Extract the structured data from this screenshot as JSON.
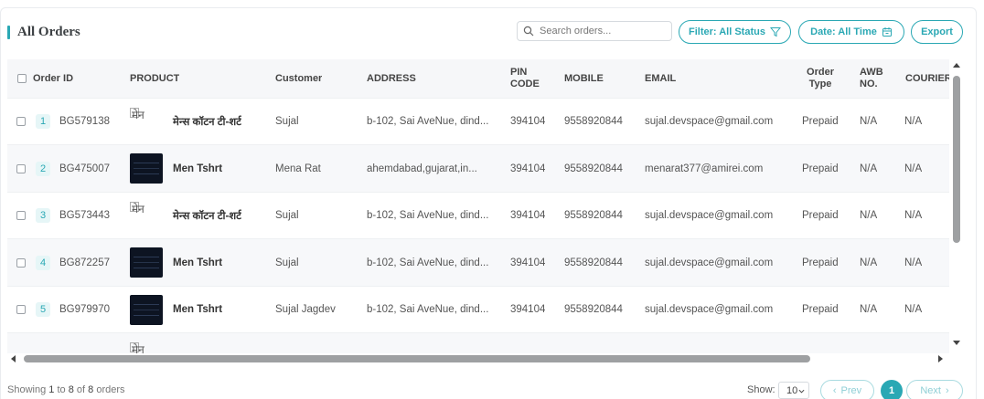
{
  "title": "All Orders",
  "search": {
    "placeholder": "Search orders..."
  },
  "buttons": {
    "filter": "Filter: All Status",
    "date": "Date: All Time",
    "export": "Export"
  },
  "columns": {
    "order_id": "Order ID",
    "product": "PRODUCT",
    "customer": "Customer",
    "address": "ADDRESS",
    "pin_code_1": "PIN",
    "pin_code_2": "CODE",
    "mobile": "MOBILE",
    "email": "EMAIL",
    "order_type_1": "Order",
    "order_type_2": "Type",
    "awb_1": "AWB",
    "awb_2": "NO.",
    "courier": "COURIER"
  },
  "rows": [
    {
      "index": "1",
      "order_id": "BG579138",
      "product_img_alt": "मेन",
      "product_name": "मेन्स कॉटन टी-शर्ट",
      "customer": "Sujal",
      "address": "b-102, Sai AveNue, dind...",
      "pin": "394104",
      "mobile": "9558920844",
      "email": "sujal.devspace@gmail.com",
      "order_type": "Prepaid",
      "awb": "N/A",
      "courier": "N/A"
    },
    {
      "index": "2",
      "order_id": "BG475007",
      "product_name": "Men Tshrt",
      "customer": "Mena Rat",
      "address": "ahemdabad,gujarat,in...",
      "pin": "394104",
      "mobile": "9558920844",
      "email": "menarat377@amirei.com",
      "order_type": "Prepaid",
      "awb": "N/A",
      "courier": "N/A"
    },
    {
      "index": "3",
      "order_id": "BG573443",
      "product_img_alt": "मेन",
      "product_name": "मेन्स कॉटन टी-शर्ट",
      "customer": "Sujal",
      "address": "b-102, Sai AveNue, dind...",
      "pin": "394104",
      "mobile": "9558920844",
      "email": "sujal.devspace@gmail.com",
      "order_type": "Prepaid",
      "awb": "N/A",
      "courier": "N/A"
    },
    {
      "index": "4",
      "order_id": "BG872257",
      "product_name": "Men Tshrt",
      "customer": "Sujal",
      "address": "b-102, Sai AveNue, dind...",
      "pin": "394104",
      "mobile": "9558920844",
      "email": "sujal.devspace@gmail.com",
      "order_type": "Prepaid",
      "awb": "N/A",
      "courier": "N/A"
    },
    {
      "index": "5",
      "order_id": "BG979970",
      "product_name": "Men Tshrt",
      "customer": "Sujal Jagdev",
      "address": "b-102, Sai AveNue, dind...",
      "pin": "394104",
      "mobile": "9558920844",
      "email": "sujal.devspace@gmail.com",
      "order_type": "Prepaid",
      "awb": "N/A",
      "courier": "N/A"
    }
  ],
  "partial_row": {
    "product_img_alt": "मेन"
  },
  "footer": {
    "showing_prefix": "Showing",
    "from": "1",
    "to_word": "to",
    "to": "8",
    "of_word": "of",
    "total": "8",
    "suffix": "orders",
    "show_label": "Show:",
    "page_size": "10",
    "prev": "Prev",
    "current_page": "1",
    "next": "Next"
  },
  "colors": {
    "accent": "#2aa8b4",
    "header_bg": "#f6f7f9",
    "scrollbar": "#9ea0a2"
  }
}
